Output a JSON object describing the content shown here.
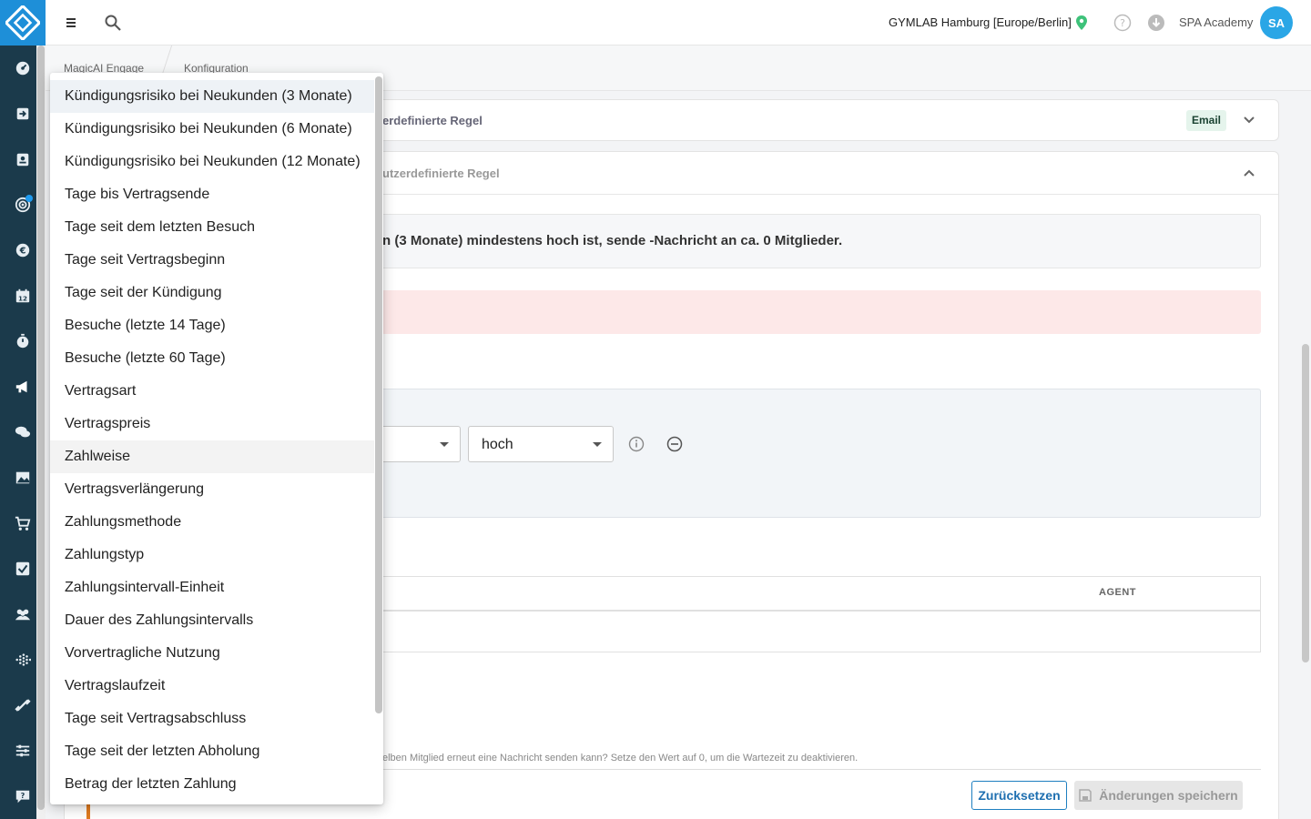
{
  "header": {
    "studio": "GYMLAB Hamburg [Europe/Berlin]",
    "account": "SPA Academy",
    "avatar_initials": "SA"
  },
  "breadcrumb": {
    "items": [
      "MagicAI Engage",
      "Konfiguration"
    ]
  },
  "rules": {
    "rule1_title": "erdefinierte Regel",
    "rule1_badge": "Email",
    "rule2_title": "utzerdefinierte Regel",
    "summary": "n (3 Monate) mindestens hoch ist, sende -Nachricht an ca. 0 Mitglieder.",
    "level_value": "hoch",
    "table_agent_header": "AGENT",
    "hint": "elben Mitglied erneut eine Nachricht senden kann? Setze den Wert auf 0, um die Wartezeit zu deaktivieren."
  },
  "buttons": {
    "reset": "Zurücksetzen",
    "save": "Änderungen speichern"
  },
  "dropdown": {
    "items": [
      "Kündigungsrisiko bei Neukunden (3 Monate)",
      "Kündigungsrisiko bei Neukunden (6 Monate)",
      "Kündigungsrisiko bei Neukunden (12 Monate)",
      "Tage bis Vertragsende",
      "Tage seit dem letzten Besuch",
      "Tage seit Vertragsbeginn",
      "Tage seit der Kündigung",
      "Besuche (letzte 14 Tage)",
      "Besuche (letzte 60 Tage)",
      "Vertragsart",
      "Vertragspreis",
      "Zahlweise",
      "Vertragsverlängerung",
      "Zahlungsmethode",
      "Zahlungstyp",
      "Zahlungsintervall-Einheit",
      "Dauer des Zahlungsintervalls",
      "Vorvertragliche Nutzung",
      "Vertragslaufzeit",
      "Tage seit Vertragsabschluss",
      "Tage seit der letzten Abholung",
      "Betrag der letzten Zahlung"
    ]
  },
  "colors": {
    "sidebar": "#1b3a4b",
    "brand": "#1e8fd8",
    "accent": "#1e7fc0",
    "badge_bg": "#e5f4ec",
    "error_bg": "#fde8e8"
  },
  "icons": [
    "menu-icon",
    "search-icon",
    "location-pin-icon",
    "help-icon",
    "download-icon",
    "gauge-icon",
    "login-icon",
    "contacts-icon",
    "target-icon",
    "euro-icon",
    "calendar-icon",
    "stopwatch-icon",
    "megaphone-icon",
    "chat-icon",
    "image-icon",
    "cart-icon",
    "checkbox-icon",
    "group-icon",
    "grid-dots-icon",
    "dumbbell-icon",
    "sliders-icon",
    "help-chat-icon"
  ]
}
